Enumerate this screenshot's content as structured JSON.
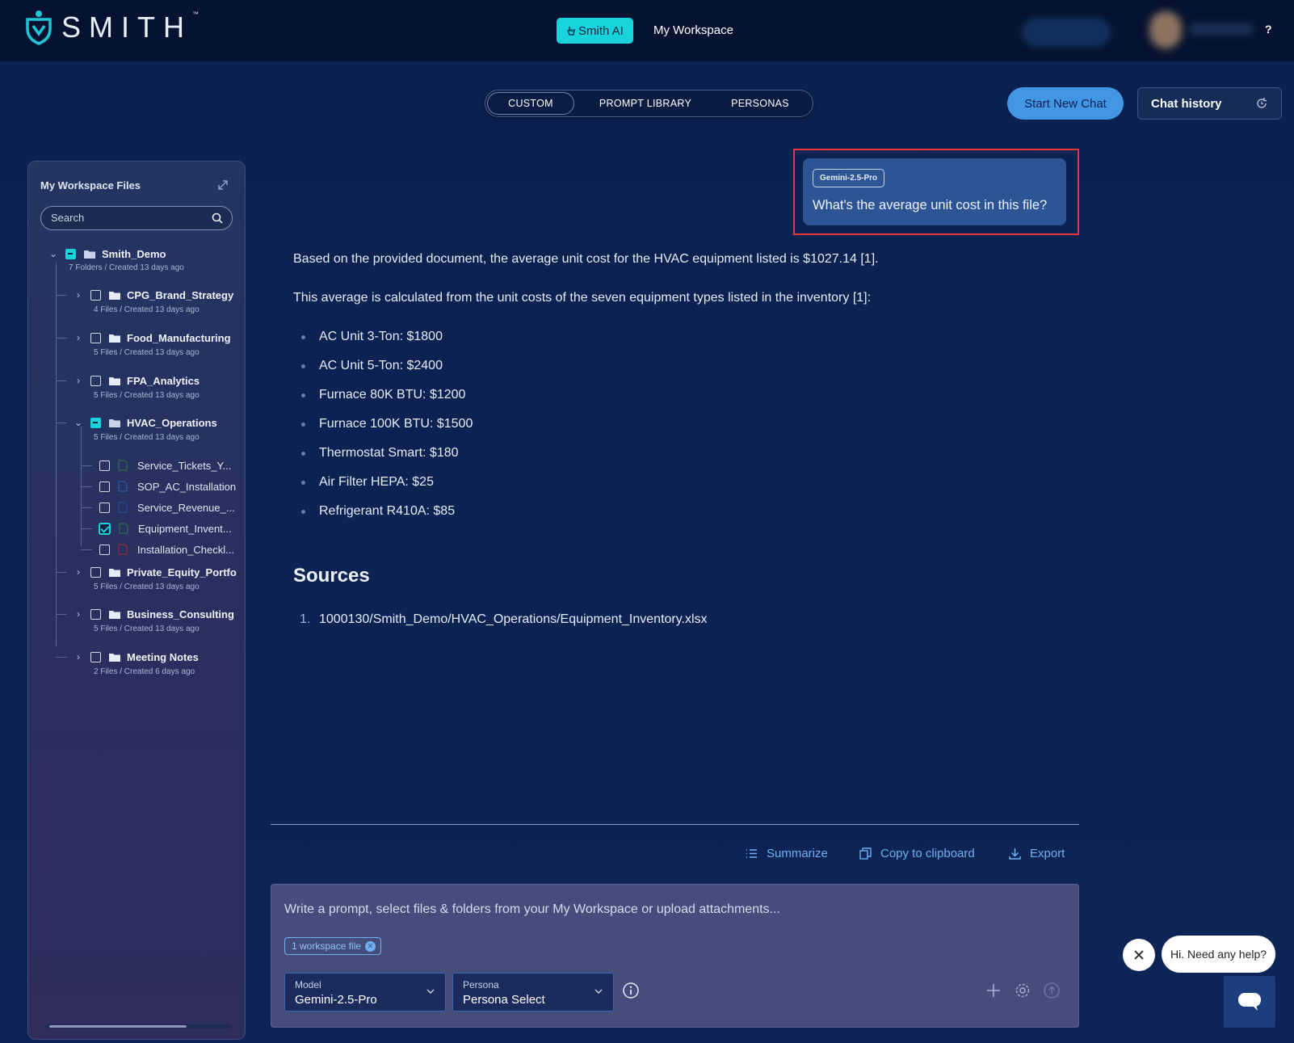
{
  "header": {
    "brand": "SMITH",
    "brand_tm": "™",
    "smith_ai_label": "Smith AI",
    "my_workspace_label": "My Workspace",
    "help_label": "?"
  },
  "tabs": [
    {
      "label": "CUSTOM",
      "active": true
    },
    {
      "label": "PROMPT LIBRARY",
      "active": false
    },
    {
      "label": "PERSONAS",
      "active": false
    }
  ],
  "actions": {
    "start_new_chat": "Start New Chat",
    "chat_history": "Chat history"
  },
  "sidebar": {
    "title": "My Workspace Files",
    "search_placeholder": "Search",
    "root": {
      "name": "Smith_Demo",
      "meta": "7 Folders / Created 13 days ago"
    },
    "folders": [
      {
        "name": "CPG_Brand_Strategy",
        "meta": "4 Files / Created 13 days ago"
      },
      {
        "name": "Food_Manufacturing",
        "meta": "5 Files / Created 13 days ago"
      },
      {
        "name": "FPA_Analytics",
        "meta": "5 Files / Created 13 days ago"
      },
      {
        "name": "HVAC_Operations",
        "meta": "5 Files / Created 13 days ago"
      },
      {
        "name": "Private_Equity_Portfo",
        "meta": "5 Files / Created 13 days ago"
      },
      {
        "name": "Business_Consulting",
        "meta": "5 Files / Created 13 days ago"
      },
      {
        "name": "Meeting Notes",
        "meta": "2 Files / Created 6 days ago"
      }
    ],
    "hvac_files": [
      {
        "name": "Service_Tickets_Y...",
        "type": "xlsx",
        "checked": false
      },
      {
        "name": "SOP_AC_Installation",
        "type": "docx",
        "checked": false
      },
      {
        "name": "Service_Revenue_...",
        "type": "docx",
        "checked": false
      },
      {
        "name": "Equipment_Invent...",
        "type": "xlsx",
        "checked": true
      },
      {
        "name": "Installation_Checkl...",
        "type": "pdf",
        "checked": false
      }
    ]
  },
  "chat": {
    "user_message": {
      "model": "Gemini-2.5-Pro",
      "text": "What's the average unit cost in this file?"
    },
    "answer": {
      "p1": "Based on the provided document, the average unit cost for the HVAC equipment listed is $1027.14 [1].",
      "p2": "This average is calculated from the unit costs of the seven equipment types listed in the inventory [1]:",
      "items": [
        "AC Unit 3-Ton: $1800",
        "AC Unit 5-Ton: $2400",
        "Furnace 80K BTU: $1200",
        "Furnace 100K BTU: $1500",
        "Thermostat Smart: $180",
        "Air Filter HEPA: $25",
        "Refrigerant R410A: $85"
      ],
      "sources_title": "Sources",
      "sources": [
        {
          "num": "1.",
          "path": "1000130/Smith_Demo/HVAC_Operations/Equipment_Inventory.xlsx"
        }
      ]
    }
  },
  "toolbar": {
    "summarize": "Summarize",
    "copy": "Copy to clipboard",
    "export": "Export"
  },
  "composer": {
    "placeholder": "Write a prompt, select files & folders from your My Workspace or upload attachments...",
    "chip": "1 workspace file",
    "model_caption": "Model",
    "model_value": "Gemini-2.5-Pro",
    "persona_caption": "Persona",
    "persona_value": "Persona Select"
  },
  "help_widget": {
    "bubble": "Hi. Need any help?"
  }
}
